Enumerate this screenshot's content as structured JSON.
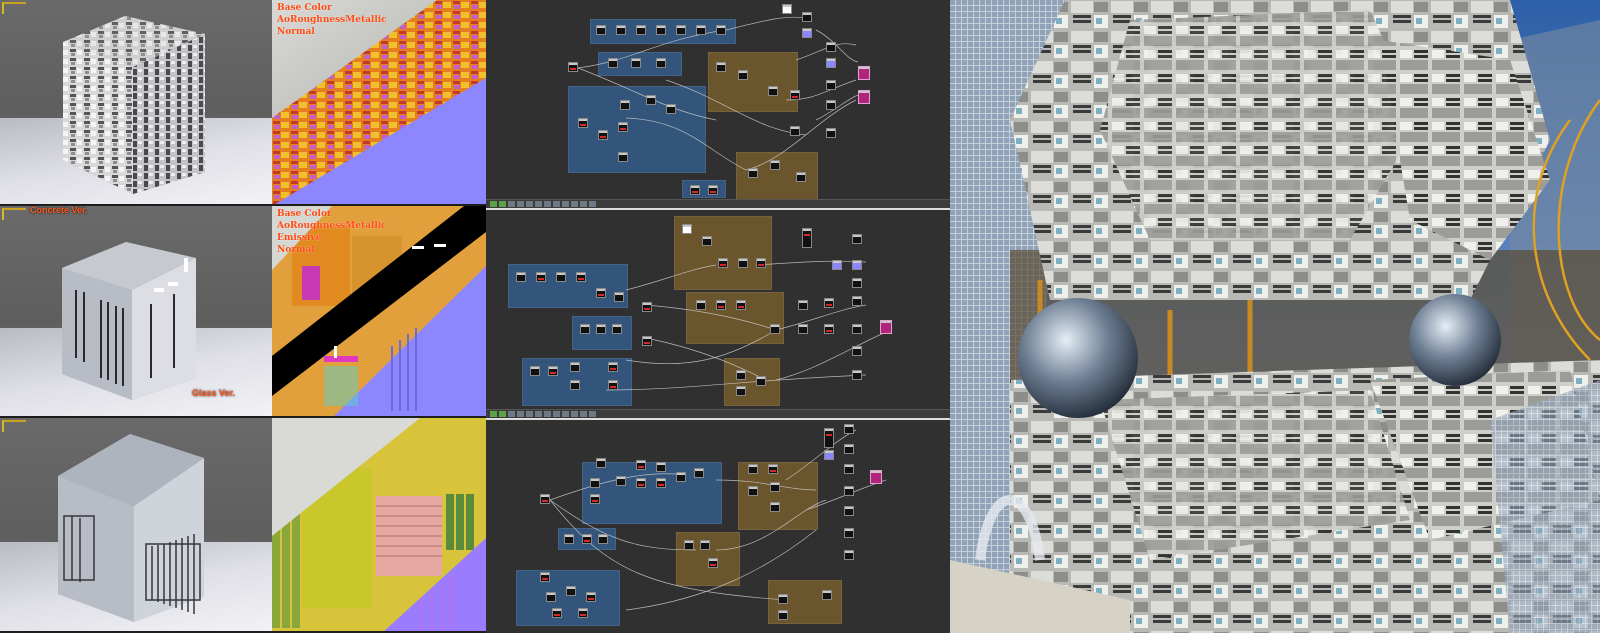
{
  "viewports": [
    {
      "label": ""
    },
    {
      "label": "Concrete Ver.",
      "label2": "Glass Ver."
    },
    {
      "label": ""
    }
  ],
  "maps": [
    {
      "lines": [
        "Base Color",
        "AoRoughnessMetallic",
        "Normal"
      ]
    },
    {
      "lines": [
        "Base Color",
        "AoRoughnessMetallic",
        "Emissive",
        "Normal"
      ]
    },
    {
      "lines": []
    }
  ],
  "colors": {
    "label_orange": "#ff4a12",
    "frame_blue": "#345c8a",
    "frame_brown": "#765c2c",
    "output_magenta": "#b0247c",
    "normal_purple": "#8a86ff"
  },
  "icons": [
    "gear-icon",
    "node-icon"
  ]
}
